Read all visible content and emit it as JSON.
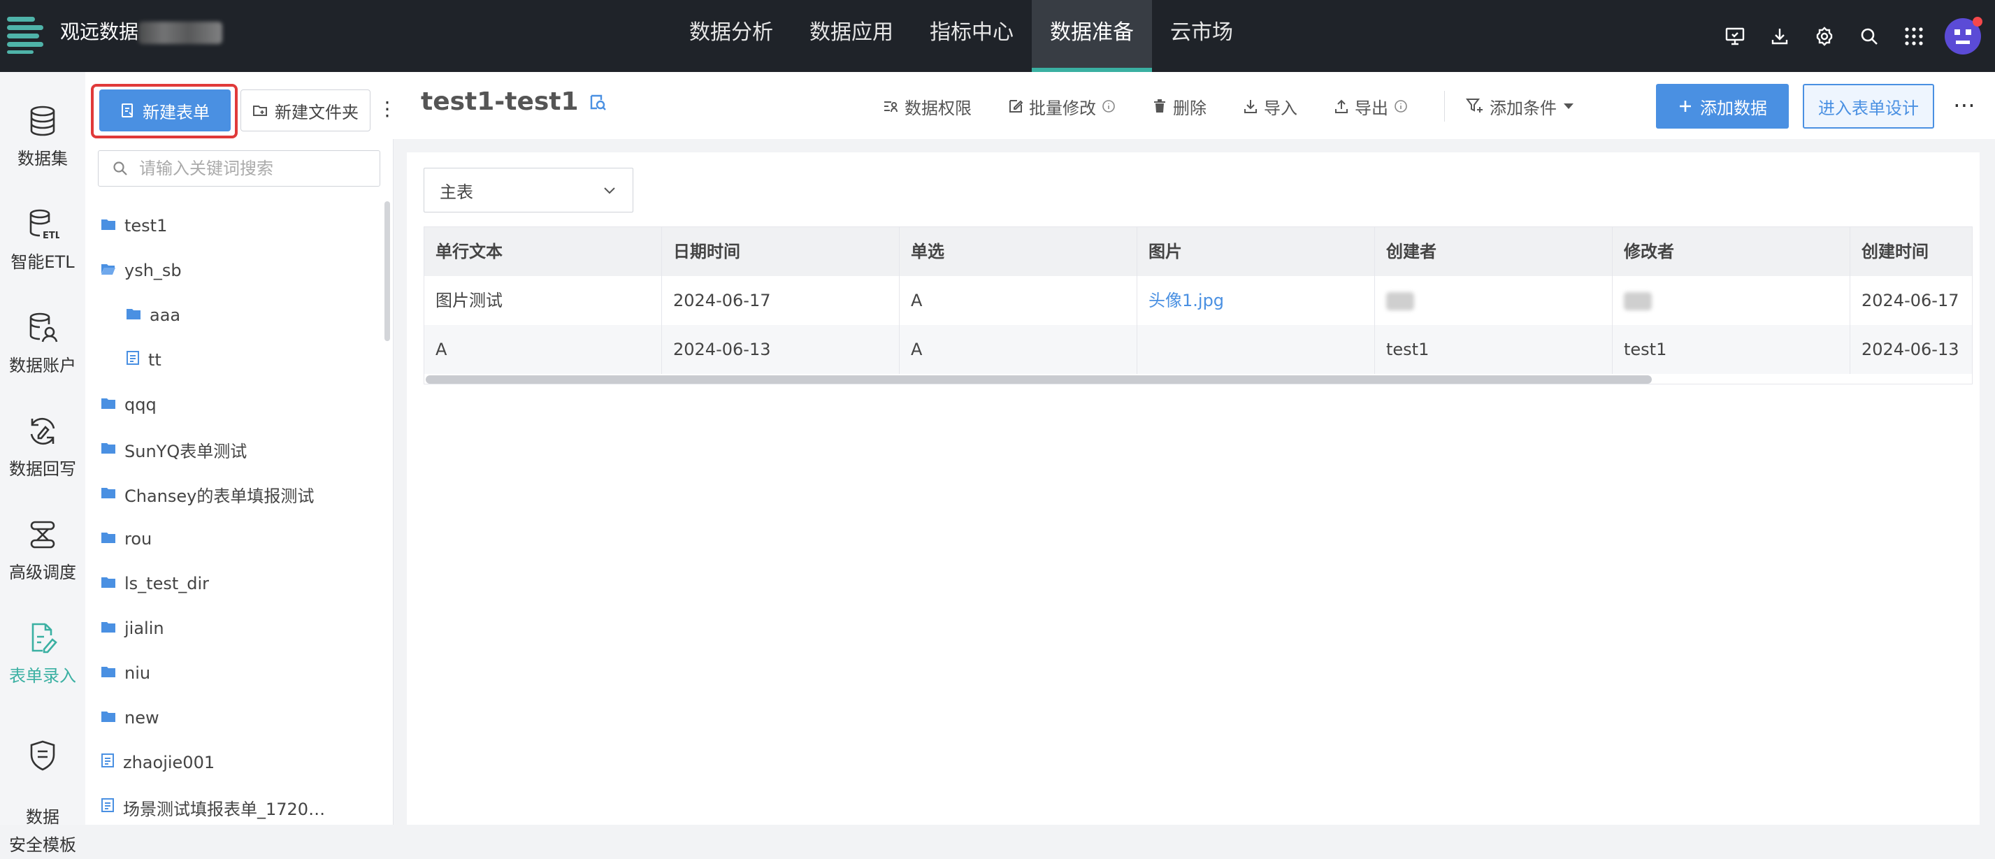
{
  "topbar": {
    "app_name": "观远数据",
    "nav": [
      "数据分析",
      "数据应用",
      "指标中心",
      "数据准备",
      "云市场"
    ],
    "active_nav": "数据准备",
    "accent": "#3ab0a2"
  },
  "rail": [
    {
      "label": "数据集",
      "icon": "database-icon"
    },
    {
      "label": "智能ETL",
      "icon": "etl-icon"
    },
    {
      "label": "数据账户",
      "icon": "data-account-icon"
    },
    {
      "label": "数据回写",
      "icon": "writeback-icon"
    },
    {
      "label": "高级调度",
      "icon": "schedule-icon"
    },
    {
      "label": "表单录入",
      "icon": "form-entry-icon"
    },
    {
      "label": "数据\n安全模板",
      "icon": "shield-doc-icon"
    }
  ],
  "sidebar": {
    "new_form": "新建表单",
    "new_folder": "新建文件夹",
    "search_placeholder": "请输入关键词搜索",
    "tree": [
      {
        "label": "test1",
        "type": "folder",
        "level": 0
      },
      {
        "label": "ysh_sb",
        "type": "folder-open",
        "level": 0
      },
      {
        "label": "aaa",
        "type": "folder",
        "level": 1
      },
      {
        "label": "tt",
        "type": "form",
        "level": 1
      },
      {
        "label": "qqq",
        "type": "folder",
        "level": 0
      },
      {
        "label": "SunYQ表单测试",
        "type": "folder",
        "level": 0
      },
      {
        "label": "Chansey的表单填报测试",
        "type": "folder",
        "level": 0
      },
      {
        "label": "rou",
        "type": "folder",
        "level": 0
      },
      {
        "label": "ls_test_dir",
        "type": "folder",
        "level": 0
      },
      {
        "label": "jialin",
        "type": "folder",
        "level": 0
      },
      {
        "label": "niu",
        "type": "folder",
        "level": 0
      },
      {
        "label": "new",
        "type": "folder",
        "level": 0
      },
      {
        "label": "zhaojie001",
        "type": "form",
        "level": 0
      },
      {
        "label": "场景测试填报表单_1720…",
        "type": "form",
        "level": 0
      }
    ]
  },
  "header": {
    "title": "test1-test1",
    "actions": [
      "数据权限",
      "批量修改",
      "删除",
      "导入",
      "导出",
      "添加条件"
    ],
    "add_data": "添加数据",
    "design": "进入表单设计"
  },
  "main": {
    "table_select": "主表",
    "columns": [
      "单行文本",
      "日期时间",
      "单选",
      "图片",
      "创建者",
      "修改者",
      "创建时间"
    ],
    "rows": [
      [
        "图片测试",
        "2024-06-17",
        "A",
        "头像1.jpg",
        "",
        "",
        "2024-06-17"
      ],
      [
        "A",
        "2024-06-13",
        "A",
        "",
        "test1",
        "test1",
        "2024-06-13"
      ]
    ]
  }
}
